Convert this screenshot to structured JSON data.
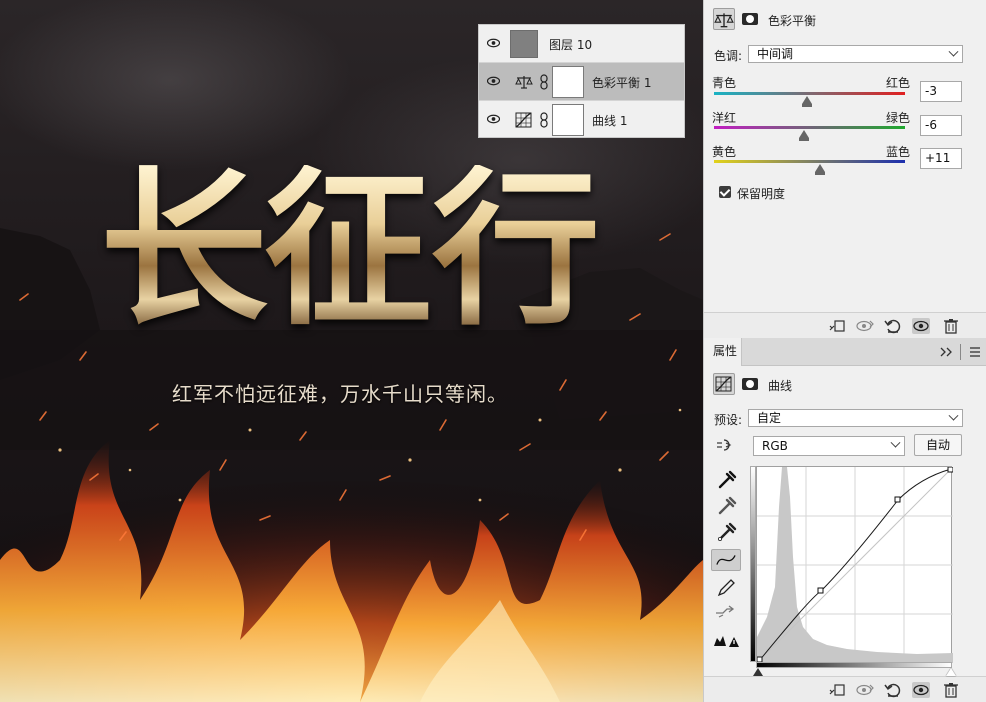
{
  "canvas": {
    "title_chars": [
      "长",
      "征",
      "行"
    ],
    "subtitle": "红军不怕远征难，万水千山只等闲。"
  },
  "layers_panel": {
    "rows": [
      {
        "name": "图层 10",
        "type": "pixel-layer",
        "selected": false
      },
      {
        "name": "色彩平衡 1",
        "type": "color-balance-adjustment",
        "selected": true
      },
      {
        "name": "曲线 1",
        "type": "curves-adjustment",
        "selected": false
      }
    ]
  },
  "color_balance_panel": {
    "title": "色彩平衡",
    "tone_label": "色调:",
    "tone_value": "中间调",
    "sliders": [
      {
        "left": "青色",
        "right": "红色",
        "value": "-3",
        "level": -3
      },
      {
        "left": "洋红",
        "right": "绿色",
        "value": "-6",
        "level": -6
      },
      {
        "left": "黄色",
        "right": "蓝色",
        "value": "+11",
        "level": 11
      }
    ],
    "preserve_luminosity_label": "保留明度",
    "preserve_luminosity": true
  },
  "properties_panel": {
    "tab_label": "属性",
    "title": "曲线",
    "preset_label": "预设:",
    "preset_value": "自定",
    "channel_value": "RGB",
    "auto_label": "自动"
  },
  "colors": {
    "panel_bg": "#f0f0f0",
    "selected_row": "#bcbcbc",
    "cyan_red": [
      "#19b3c4",
      "#e02020"
    ],
    "magenta_green": [
      "#c21ec2",
      "#1fa82e"
    ],
    "yellow_blue": [
      "#e2d21a",
      "#1c2fae"
    ]
  },
  "icons": {
    "eye": "eye-icon",
    "scales": "balance-scale-icon",
    "mask": "mask-icon",
    "curves": "curves-icon",
    "clip_to_layer": "clip-to-layer-icon",
    "view_previous": "view-previous-state-icon",
    "reset": "reset-icon",
    "visibility": "visibility-icon",
    "trash": "trash-icon",
    "panel_menu": "panel-menu-icon",
    "expand": "double-chevron-icon",
    "target_adjust": "targeted-adjustment-icon",
    "eyedropper_black": "black-point-eyedropper-icon",
    "eyedropper_gray": "gray-point-eyedropper-icon",
    "eyedropper_white": "white-point-eyedropper-icon",
    "curve_point": "edit-points-icon",
    "pencil": "pencil-icon",
    "smooth": "smooth-curve-icon",
    "clipping_warning": "clipping-warning-icon"
  }
}
